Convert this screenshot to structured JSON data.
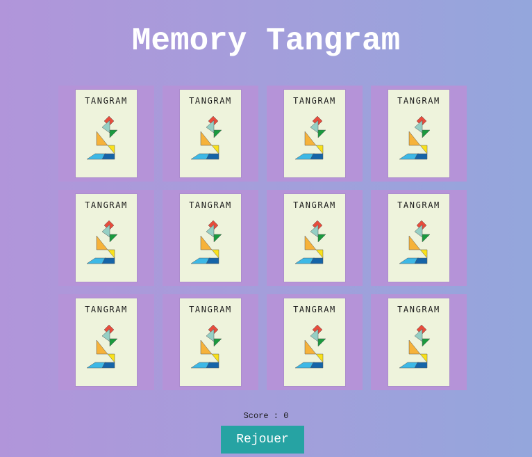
{
  "game": {
    "title": "Memory Tangram",
    "score_label": "Score",
    "score_separator": " : ",
    "score_value": "0",
    "replay_label": "Rejouer"
  },
  "cards": [
    {
      "label": "TANGRAM",
      "face": "back"
    },
    {
      "label": "TANGRAM",
      "face": "back"
    },
    {
      "label": "TANGRAM",
      "face": "back"
    },
    {
      "label": "TANGRAM",
      "face": "back"
    },
    {
      "label": "TANGRAM",
      "face": "back"
    },
    {
      "label": "TANGRAM",
      "face": "back"
    },
    {
      "label": "TANGRAM",
      "face": "back"
    },
    {
      "label": "TANGRAM",
      "face": "back"
    },
    {
      "label": "TANGRAM",
      "face": "back"
    },
    {
      "label": "TANGRAM",
      "face": "back"
    },
    {
      "label": "TANGRAM",
      "face": "back"
    },
    {
      "label": "TANGRAM",
      "face": "back"
    }
  ],
  "colors": {
    "background_start": "#b195da",
    "background_end": "#94a6dc",
    "card_frame": "#b593d8",
    "card_face": "#eef3dc",
    "button": "#26a3a3",
    "tangram_red": "#e74c3c",
    "tangram_teal": "#95cfc4",
    "tangram_green": "#1a9a3e",
    "tangram_orange": "#f6b23a",
    "tangram_yellow": "#f9e11a",
    "tangram_lightblue": "#3db8e6",
    "tangram_darkblue": "#1564a8"
  }
}
